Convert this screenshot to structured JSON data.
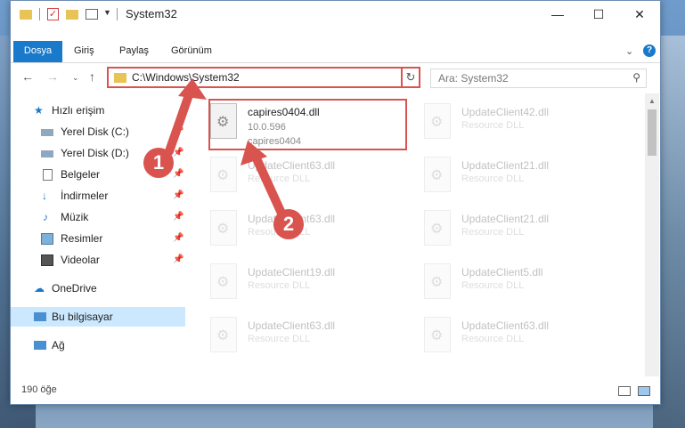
{
  "window": {
    "title": "System32",
    "controls": {
      "minimize": "—",
      "maximize": "☐",
      "close": "✕"
    }
  },
  "ribbon": {
    "tabs": [
      "Dosya",
      "Giriş",
      "Paylaş",
      "Görünüm"
    ],
    "expand_glyph": "⌄",
    "help_glyph": "?"
  },
  "nav": {
    "back": "←",
    "forward": "→",
    "recent": "⌄",
    "up": "↑",
    "address": "C:\\Windows\\System32",
    "address_dd": "⌄",
    "refresh": "↻",
    "search_placeholder": "Ara: System32",
    "search_glyph": "⚲"
  },
  "sidebar": {
    "items": [
      {
        "label": "Hızlı erişim",
        "icon": "star-icon"
      },
      {
        "label": "Yerel Disk (C:)",
        "icon": "drive-icon",
        "pin": "📌"
      },
      {
        "label": "Yerel Disk (D:)",
        "icon": "drive-icon",
        "pin": "📌"
      },
      {
        "label": "Belgeler",
        "icon": "documents-icon",
        "pin": "📌"
      },
      {
        "label": "İndirmeler",
        "icon": "download-icon",
        "pin": "📌"
      },
      {
        "label": "Müzik",
        "icon": "music-icon",
        "pin": "📌"
      },
      {
        "label": "Resimler",
        "icon": "pictures-icon",
        "pin": "📌"
      },
      {
        "label": "Videolar",
        "icon": "videos-icon",
        "pin": "📌"
      },
      {
        "label": "OneDrive",
        "icon": "cloud-icon"
      },
      {
        "label": "Bu bilgisayar",
        "icon": "computer-icon",
        "selected": true
      },
      {
        "label": "Ağ",
        "icon": "network-icon"
      }
    ]
  },
  "files": [
    {
      "name": "capires0404.dll",
      "line2": "10.0.596",
      "line3": "capires0404",
      "highlighted": true
    },
    {
      "name": "UpdateClient42.dll",
      "line2": "Resource DLL"
    },
    {
      "name": "UpdateClient63.dll",
      "line2": "Resource DLL"
    },
    {
      "name": "UpdateClient21.dll",
      "line2": "Resource DLL"
    },
    {
      "name": "UpdateClient63.dll",
      "line2": "Resource DLL"
    },
    {
      "name": "UpdateClient21.dll",
      "line2": "Resource DLL"
    },
    {
      "name": "UpdateClient19.dll",
      "line2": "Resource DLL"
    },
    {
      "name": "UpdateClient5.dll",
      "line2": "Resource DLL"
    },
    {
      "name": "UpdateClient63.dll",
      "line2": "Resource DLL"
    },
    {
      "name": "UpdateClient63.dll",
      "line2": "Resource DLL"
    }
  ],
  "status": {
    "item_count": "190 öğe"
  },
  "annotations": {
    "step1": "1",
    "step2": "2",
    "color": "#d9534f"
  }
}
